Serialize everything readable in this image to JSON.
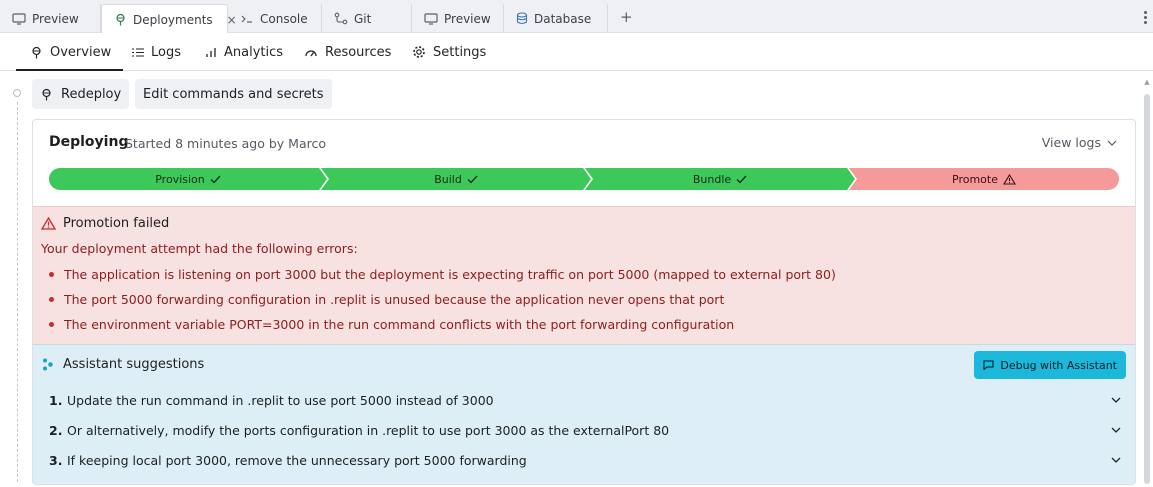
{
  "tabs": [
    {
      "label": "Preview",
      "icon": "monitor-icon"
    },
    {
      "label": "Deployments",
      "icon": "deploy-icon",
      "close": "×"
    },
    {
      "label": "Console",
      "icon": "terminal-icon"
    },
    {
      "label": "Git",
      "icon": "git-icon"
    },
    {
      "label": "Preview",
      "icon": "monitor-icon"
    },
    {
      "label": "Database",
      "icon": "database-icon"
    }
  ],
  "new_tab": "+",
  "subnav": [
    {
      "label": "Overview",
      "icon": "deploy-icon"
    },
    {
      "label": "Logs",
      "icon": "list-icon"
    },
    {
      "label": "Analytics",
      "icon": "bar-chart-icon"
    },
    {
      "label": "Resources",
      "icon": "gauge-icon"
    },
    {
      "label": "Settings",
      "icon": "gear-icon"
    }
  ],
  "actions": {
    "redeploy": "Redeploy",
    "edit": "Edit commands and secrets"
  },
  "deployment": {
    "status": "Deploying",
    "started": "Started 8 minutes ago by Marco",
    "view_logs": "View logs",
    "stages": [
      {
        "label": "Provision",
        "state": "ok"
      },
      {
        "label": "Build",
        "state": "ok"
      },
      {
        "label": "Bundle",
        "state": "ok"
      },
      {
        "label": "Promote",
        "state": "fail"
      }
    ]
  },
  "error": {
    "title": "Promotion failed",
    "intro": "Your deployment attempt had the following errors:",
    "items": [
      "The application is listening on port 3000 but the deployment is expecting traffic on port 5000 (mapped to external port 80)",
      "The port 5000 forwarding configuration in .replit is unused because the application never opens that port",
      "The environment variable PORT=3000 in the run command conflicts with the port forwarding configuration"
    ]
  },
  "assistant": {
    "title": "Assistant suggestions",
    "debug_button": "Debug with Assistant",
    "suggestions": [
      {
        "num": "1.",
        "text": "Update the run command in .replit to use port 5000 instead of 3000"
      },
      {
        "num": "2.",
        "text": "Or alternatively, modify the ports configuration in .replit to use port 3000 as the externalPort 80"
      },
      {
        "num": "3.",
        "text": "If keeping local port 3000, remove the unnecessary port 5000 forwarding"
      }
    ]
  },
  "colors": {
    "stage_ok": "#3cc95a",
    "stage_fail": "#f59a9a",
    "error_bg": "#f7e1e1",
    "error_text": "#8f1d1d",
    "assist_bg": "#ddeef6",
    "debug_btn": "#1cb8dc"
  }
}
